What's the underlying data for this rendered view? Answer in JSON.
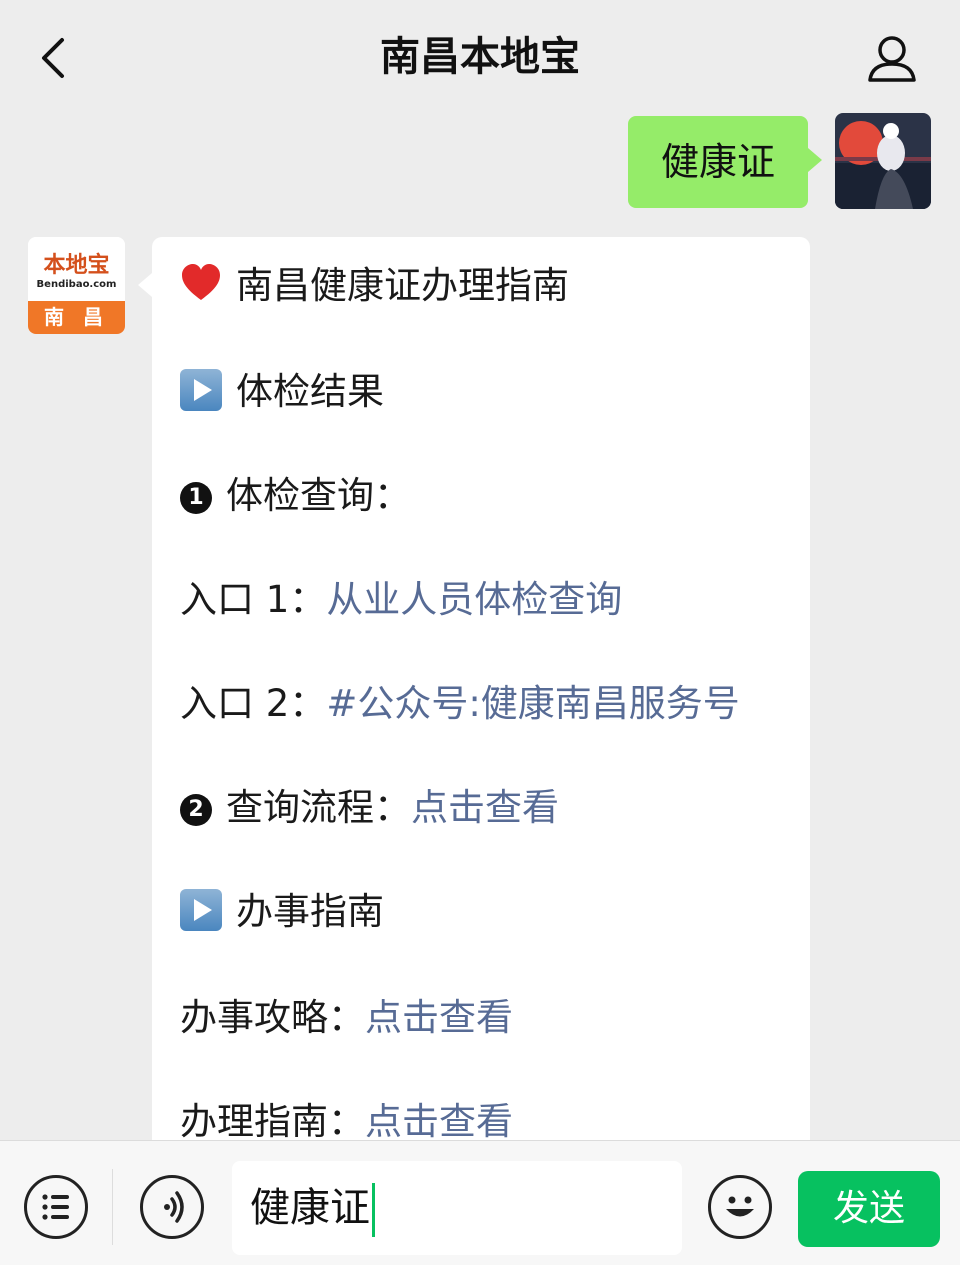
{
  "header": {
    "title": "南昌本地宝",
    "back_icon": "chevron-left-icon",
    "profile_icon": "person-icon"
  },
  "chat": {
    "outgoing": {
      "text": "健康证"
    },
    "incoming": {
      "avatar": {
        "brand": "本地宝",
        "domain": "Bendibao.com",
        "city": "南 昌"
      },
      "lines": [
        {
          "text": "南昌健康证办理指南"
        },
        {
          "text": "体检结果"
        },
        {
          "text": "体检查询：",
          "num": "1"
        },
        {
          "label": "入口 1：",
          "link": "从业人员体检查询"
        },
        {
          "label": "入口 2：",
          "link": "#公众号:健康南昌服务号"
        },
        {
          "label": "查询流程：",
          "link": "点击查看",
          "num": "2"
        },
        {
          "text": "办事指南"
        },
        {
          "label": "办事攻略：",
          "link": "点击查看"
        },
        {
          "label": "办理指南：",
          "link": "点击查看"
        }
      ]
    }
  },
  "input_bar": {
    "value": "健康证",
    "send_label": "发送"
  },
  "colors": {
    "background": "#ededed",
    "outgoing_bubble": "#95ec69",
    "link": "#576b95",
    "send_button": "#07c160"
  }
}
